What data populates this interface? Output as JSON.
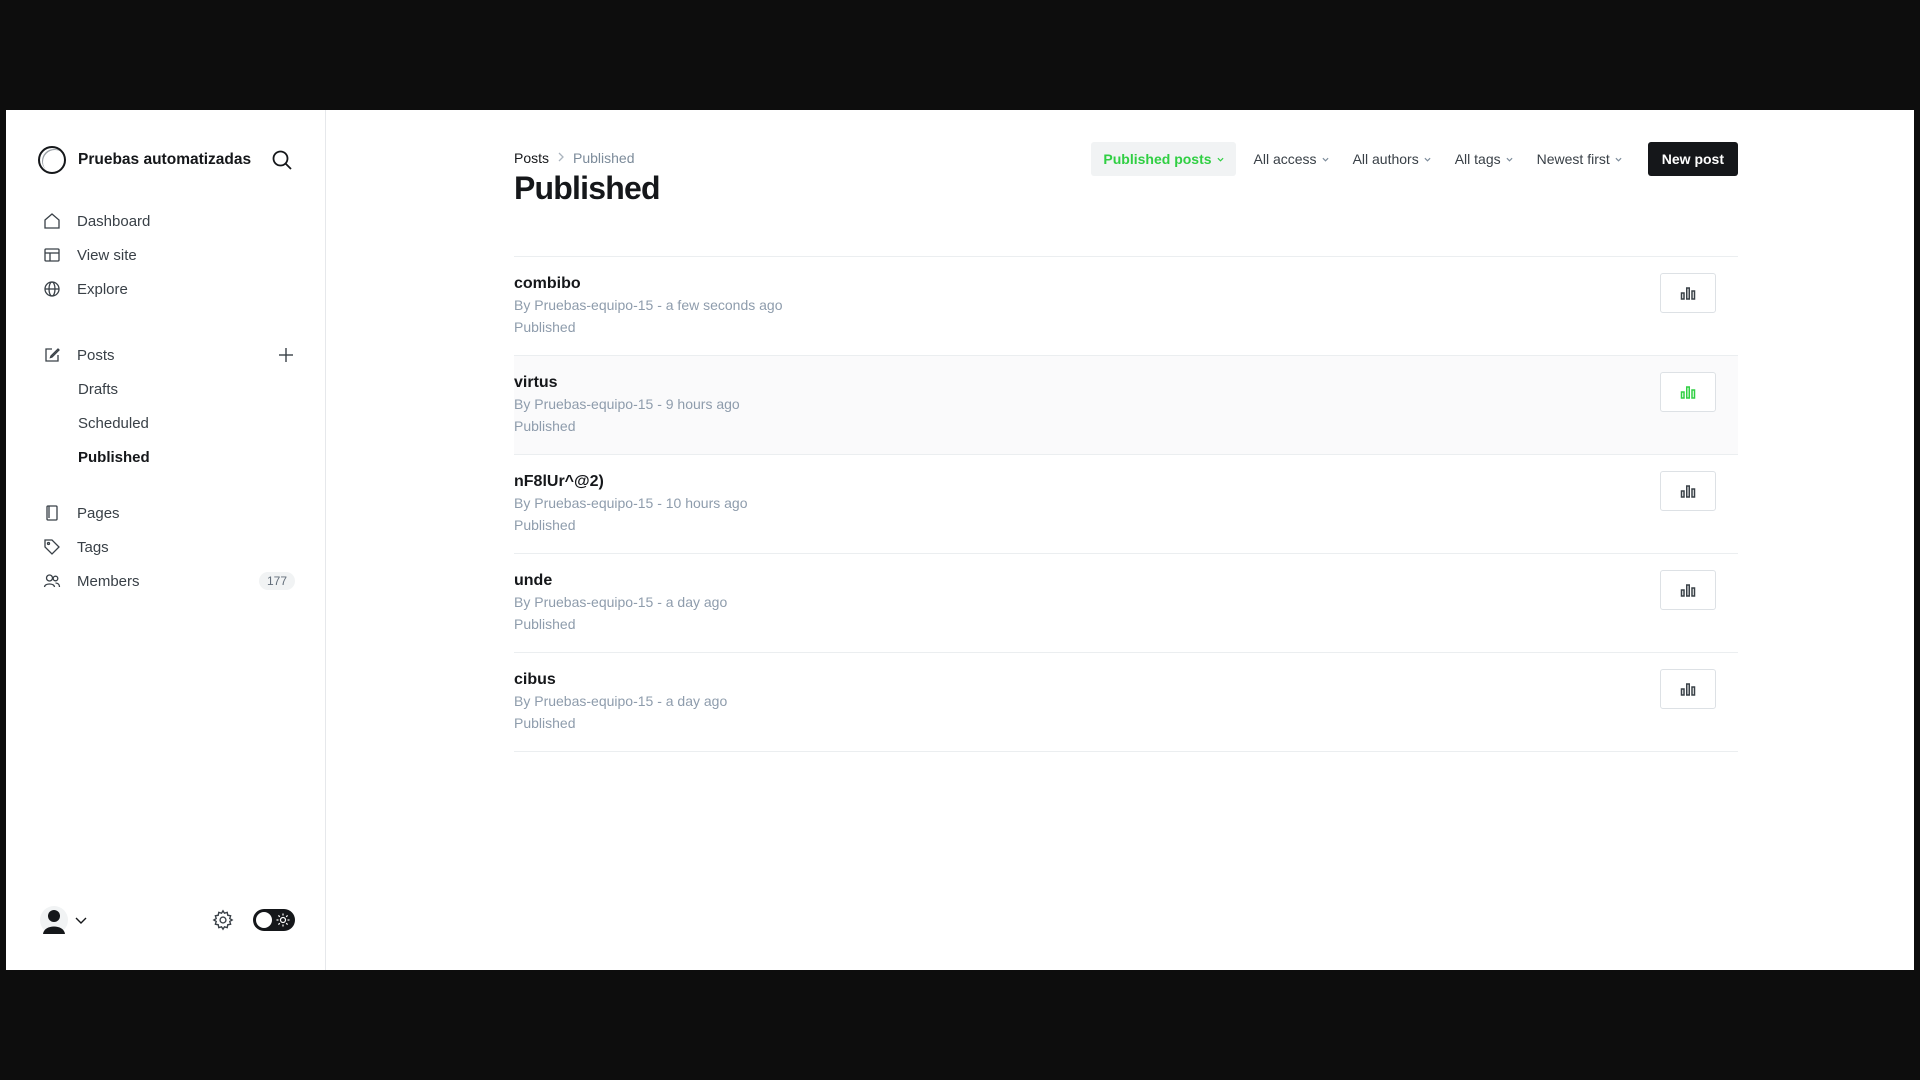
{
  "site": {
    "name": "Pruebas automatizadas"
  },
  "nav": {
    "dashboard": "Dashboard",
    "view_site": "View site",
    "explore": "Explore",
    "posts": "Posts",
    "drafts": "Drafts",
    "scheduled": "Scheduled",
    "published": "Published",
    "pages": "Pages",
    "tags": "Tags",
    "members": "Members",
    "members_count": "177"
  },
  "breadcrumb": {
    "parent": "Posts",
    "current": "Published"
  },
  "page_title": "Published",
  "filters": {
    "type": "Published posts",
    "access": "All access",
    "authors": "All authors",
    "tags": "All tags",
    "order": "Newest first"
  },
  "new_post_label": "New post",
  "posts": [
    {
      "title": "combibo",
      "meta": "By Pruebas-equipo-15 - a few seconds ago",
      "status": "Published"
    },
    {
      "title": "virtus",
      "meta": "By Pruebas-equipo-15 - 9 hours ago",
      "status": "Published"
    },
    {
      "title": "nF8lUr^@2)",
      "meta": "By Pruebas-equipo-15 - 10 hours ago",
      "status": "Published"
    },
    {
      "title": "unde",
      "meta": "By Pruebas-equipo-15 - a day ago",
      "status": "Published"
    },
    {
      "title": "cibus",
      "meta": "By Pruebas-equipo-15 - a day ago",
      "status": "Published"
    }
  ],
  "colors": {
    "accent_green": "#30cf43",
    "dark": "#15171a"
  },
  "icons": [
    "search-icon",
    "home-icon",
    "view-site-icon",
    "globe-icon",
    "edit-icon",
    "plus-icon",
    "pages-icon",
    "tag-icon",
    "members-icon",
    "avatar-icon",
    "chevron-down-icon",
    "gear-icon",
    "sun-icon",
    "analytics-icon"
  ]
}
